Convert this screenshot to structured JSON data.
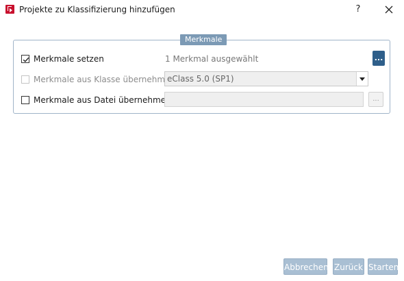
{
  "window": {
    "title": "Projekte zu Klassifizierung hinzufügen",
    "help_label": "?",
    "app_icon": "app-logo-icon",
    "close_icon": "close-icon"
  },
  "group": {
    "legend": "Merkmale",
    "rows": [
      {
        "label": "Merkmale setzen",
        "checked": true,
        "enabled": true,
        "value": "1 Merkmal ausgewählt",
        "action_label": "..."
      },
      {
        "label": "Merkmale aus Klasse übernehmen",
        "checked": false,
        "enabled": false,
        "select_value": "eClass 5.0 (SP1)"
      },
      {
        "label": "Merkmale aus Datei übernehmen",
        "checked": false,
        "enabled": true,
        "file_value": "",
        "browse_label": "..."
      }
    ]
  },
  "footer": {
    "cancel_label": "Abbrechen",
    "back_label": "Zurück",
    "start_label": "Starten"
  },
  "colors": {
    "legend_bg": "#7c9ab5",
    "primary_button": "#2f5f8a",
    "footer_button": "#a9bfd3",
    "group_border": "#9fb3c8",
    "app_icon": "#c8102e"
  }
}
